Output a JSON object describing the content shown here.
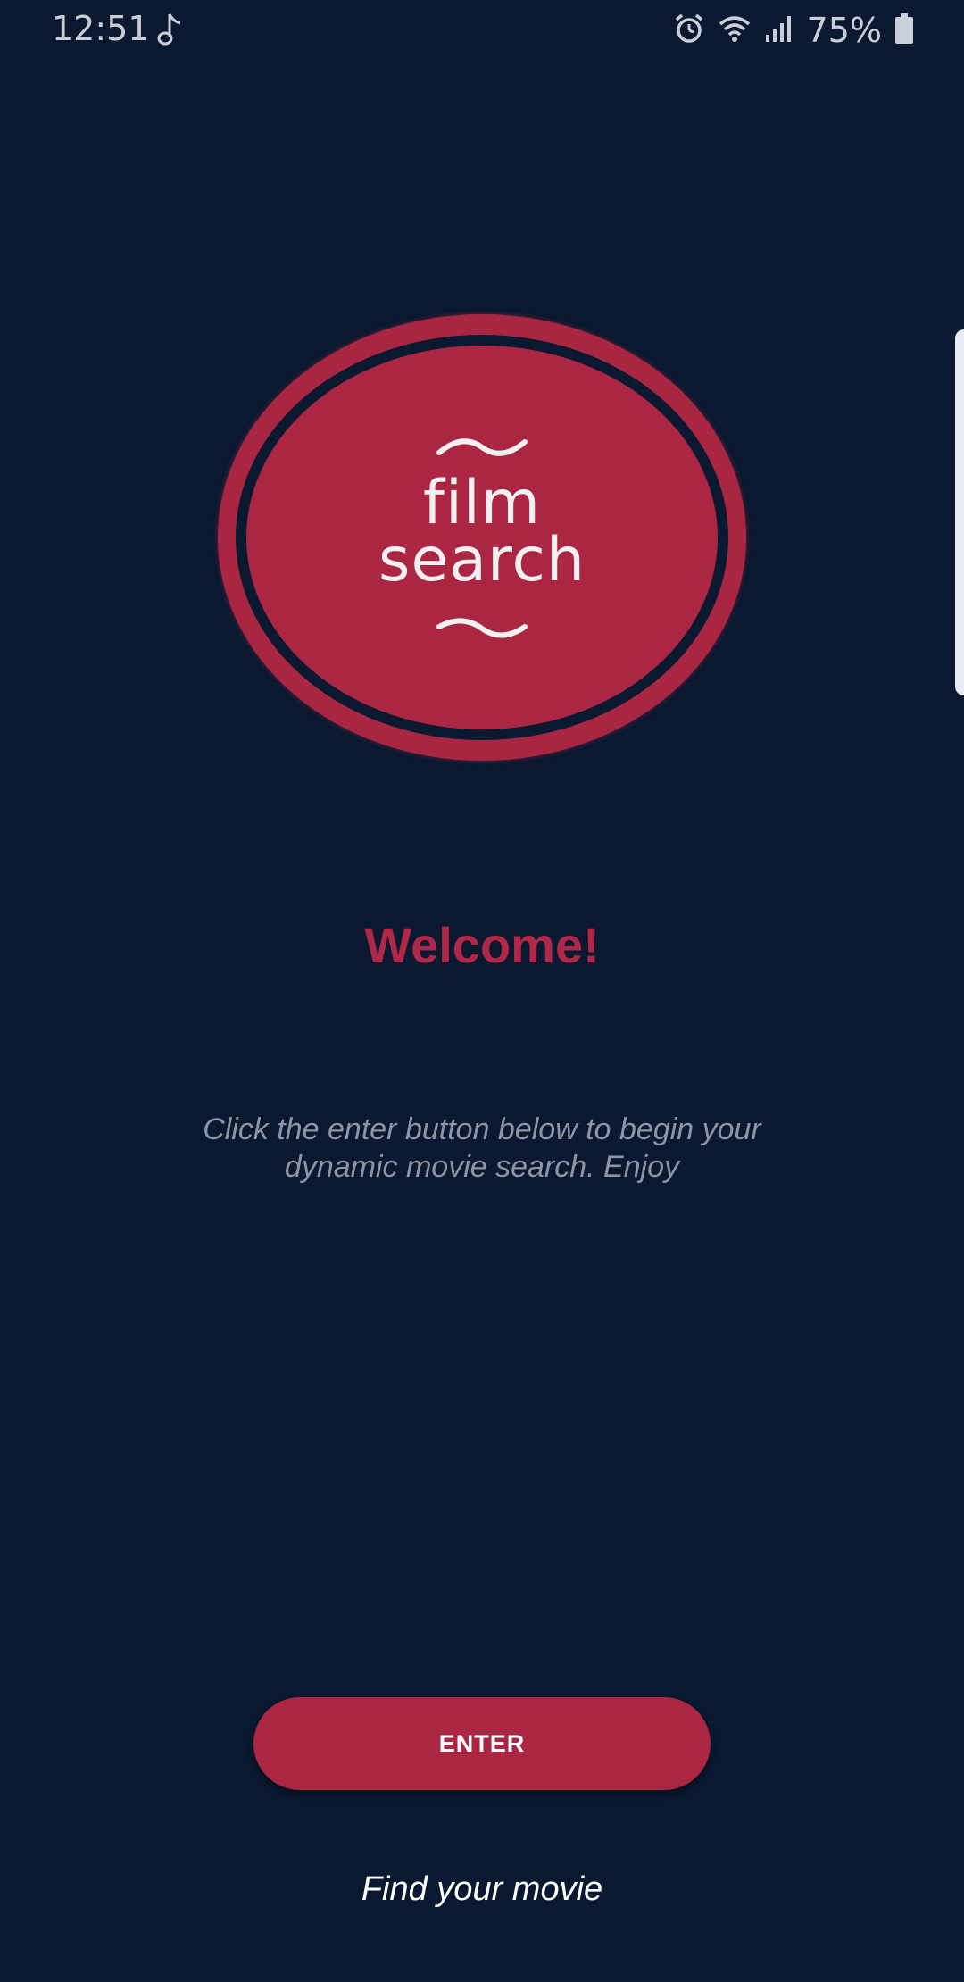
{
  "status_bar": {
    "time": "12:51",
    "battery_percent": "75%",
    "icons": [
      "music-note-icon",
      "alarm-icon",
      "wifi-icon",
      "signal-icon",
      "battery-icon"
    ],
    "text_color": "#c9ced8"
  },
  "logo": {
    "line1": "film",
    "line2": "search",
    "color": "#ab2643"
  },
  "welcome": {
    "title": "Welcome!",
    "message": "Click the enter button below to begin your dynamic movie search. Enjoy"
  },
  "actions": {
    "enter_label": "ENTER"
  },
  "footer": {
    "tagline": "Find your movie"
  },
  "theme": {
    "background": "#0a1830",
    "accent": "#ab2643"
  }
}
